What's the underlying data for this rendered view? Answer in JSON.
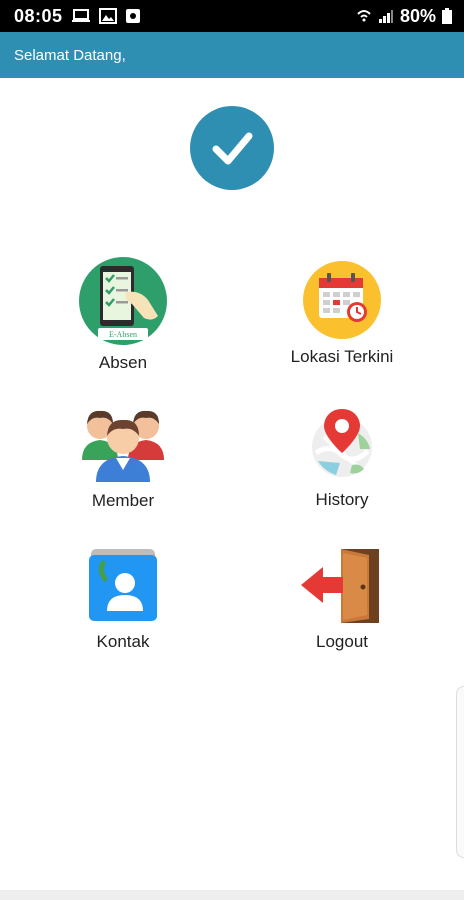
{
  "status_bar": {
    "time": "08:05",
    "battery": "80%",
    "icons": [
      "laptop-icon",
      "image-icon",
      "app-notification-icon",
      "wifi-icon",
      "signal-icon",
      "battery-icon"
    ]
  },
  "app_bar": {
    "title": "Selamat Datang,",
    "color": "#2f8fb3"
  },
  "header_icon": "check-icon",
  "menu": {
    "items": [
      {
        "label": "Absen",
        "icon": "e-absen-icon",
        "icon_text": "E-Absen"
      },
      {
        "label": "Lokasi Terkini",
        "icon": "calendar-icon"
      },
      {
        "label": "Member",
        "icon": "group-icon"
      },
      {
        "label": "History",
        "icon": "map-pin-icon"
      },
      {
        "label": "Kontak",
        "icon": "contact-icon"
      },
      {
        "label": "Logout",
        "icon": "door-exit-icon"
      }
    ]
  }
}
